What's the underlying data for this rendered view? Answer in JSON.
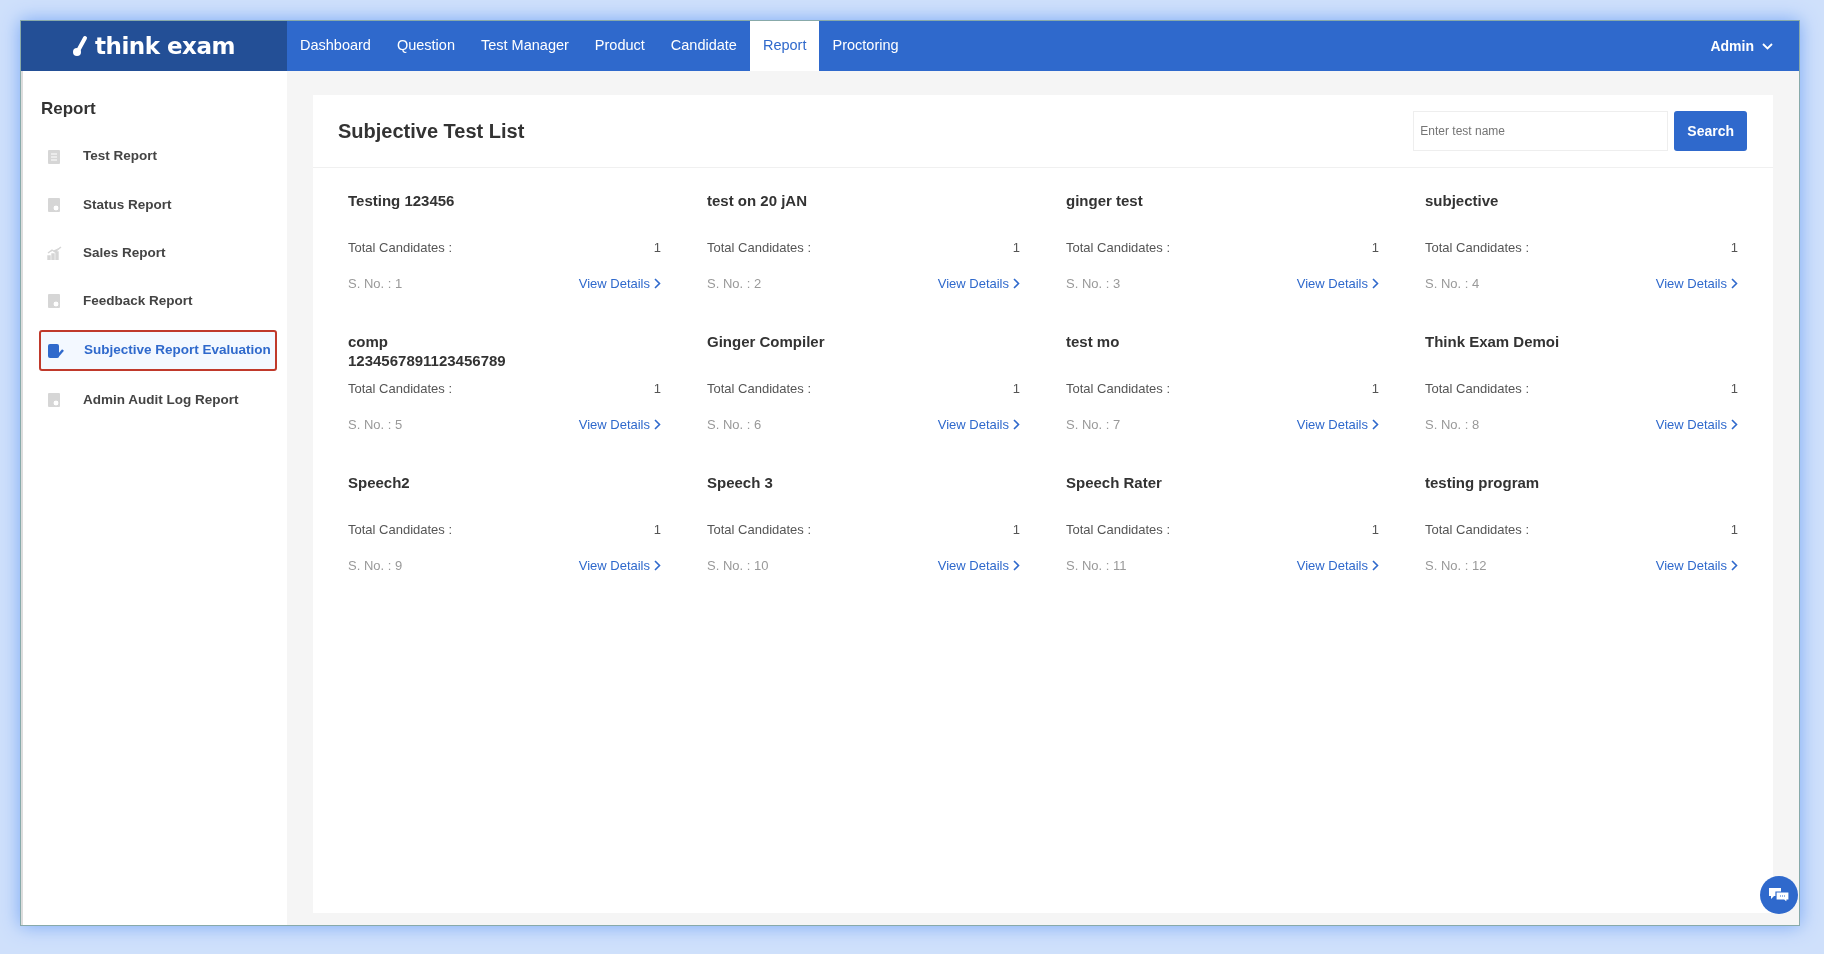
{
  "logo": {
    "text": "think exam"
  },
  "nav": [
    {
      "label": "Dashboard",
      "selected": false
    },
    {
      "label": "Question",
      "selected": false
    },
    {
      "label": "Test Manager",
      "selected": false
    },
    {
      "label": "Product",
      "selected": false
    },
    {
      "label": "Candidate",
      "selected": false
    },
    {
      "label": "Report",
      "selected": true
    },
    {
      "label": "Proctoring",
      "selected": false
    }
  ],
  "user_menu": {
    "label": "Admin"
  },
  "sidebar": {
    "title": "Report",
    "items": [
      {
        "label": "Test Report",
        "selected": false
      },
      {
        "label": "Status Report",
        "selected": false
      },
      {
        "label": "Sales Report",
        "selected": false
      },
      {
        "label": "Feedback Report",
        "selected": false
      },
      {
        "label": "Subjective Report Evaluation",
        "selected": true
      },
      {
        "label": "Admin Audit Log Report",
        "selected": false
      }
    ]
  },
  "page": {
    "title": "Subjective Test List",
    "search": {
      "placeholder": "Enter test name",
      "button": "Search"
    }
  },
  "tests": [
    {
      "title": "Testing 123456",
      "total_label": "Total Candidates :",
      "total": "1",
      "serial": "S. No. : 1",
      "link": "View Details"
    },
    {
      "title": "test on 20 jAN",
      "total_label": "Total Candidates :",
      "total": "1",
      "serial": "S. No. : 2",
      "link": "View Details"
    },
    {
      "title": "ginger test",
      "total_label": "Total Candidates :",
      "total": "1",
      "serial": "S. No. : 3",
      "link": "View Details"
    },
    {
      "title": "subjective",
      "total_label": "Total Candidates :",
      "total": "1",
      "serial": "S. No. : 4",
      "link": "View Details"
    },
    {
      "title": "comp 1234567891123456789",
      "total_label": "Total Candidates :",
      "total": "1",
      "serial": "S. No. : 5",
      "link": "View Details"
    },
    {
      "title": "Ginger Compiler",
      "total_label": "Total Candidates :",
      "total": "1",
      "serial": "S. No. : 6",
      "link": "View Details"
    },
    {
      "title": "test mo",
      "total_label": "Total Candidates :",
      "total": "1",
      "serial": "S. No. : 7",
      "link": "View Details"
    },
    {
      "title": "Think Exam Demoi",
      "total_label": "Total Candidates :",
      "total": "1",
      "serial": "S. No. : 8",
      "link": "View Details"
    },
    {
      "title": "Speech2",
      "total_label": "Total Candidates :",
      "total": "1",
      "serial": "S. No. : 9",
      "link": "View Details"
    },
    {
      "title": "Speech 3",
      "total_label": "Total Candidates :",
      "total": "1",
      "serial": "S. No. : 10",
      "link": "View Details"
    },
    {
      "title": "Speech Rater",
      "total_label": "Total Candidates :",
      "total": "1",
      "serial": "S. No. : 11",
      "link": "View Details"
    },
    {
      "title": "testing program",
      "total_label": "Total Candidates :",
      "total": "1",
      "serial": "S. No. : 12",
      "link": "View Details"
    }
  ]
}
